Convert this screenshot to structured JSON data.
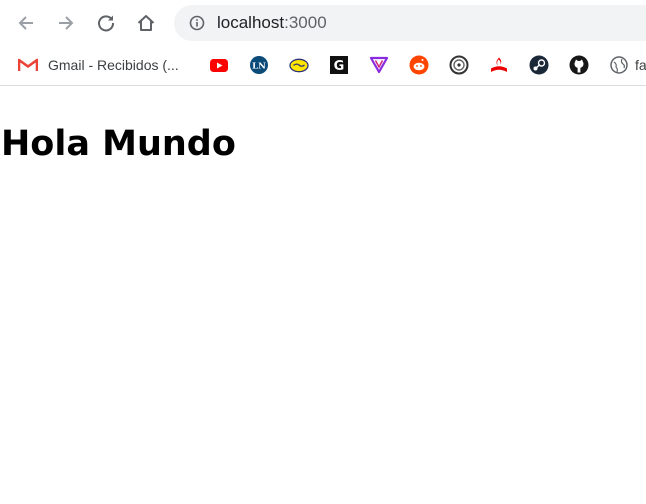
{
  "toolbar": {
    "back_icon": "arrow-back-icon",
    "forward_icon": "arrow-forward-icon",
    "reload_icon": "reload-icon",
    "home_icon": "home-icon"
  },
  "omnibox": {
    "security_icon": "info-icon",
    "url_host": "localhost",
    "url_port": ":3000"
  },
  "bookmarks": [
    {
      "label": "Gmail - Recibidos (...",
      "icon": "gmail-icon"
    },
    {
      "label": "",
      "icon": "youtube-icon"
    },
    {
      "label": "",
      "icon": "ln-icon"
    },
    {
      "label": "",
      "icon": "mercadolibre-icon"
    },
    {
      "label": "",
      "icon": "g-icon"
    },
    {
      "label": "",
      "icon": "v-icon"
    },
    {
      "label": "",
      "icon": "reddit-icon"
    },
    {
      "label": "",
      "icon": "wheel-icon"
    },
    {
      "label": "",
      "icon": "santander-icon"
    },
    {
      "label": "",
      "icon": "steam-icon"
    },
    {
      "label": "",
      "icon": "github-icon"
    },
    {
      "label": "fa",
      "icon": "globe-icon"
    }
  ],
  "page": {
    "heading": "Hola Mundo"
  },
  "colors": {
    "omnibox_bg": "#f1f3f4",
    "icon_gray": "#5f6368",
    "icon_disabled": "#9aa0a6",
    "youtube_red": "#ff0000",
    "reddit_orange": "#ff4500",
    "santander_red": "#ec0000",
    "linkedin_ln_blue": "#0a4b7a",
    "vivo_purple": "#8a2be2",
    "steam_dark": "#1b2838"
  }
}
